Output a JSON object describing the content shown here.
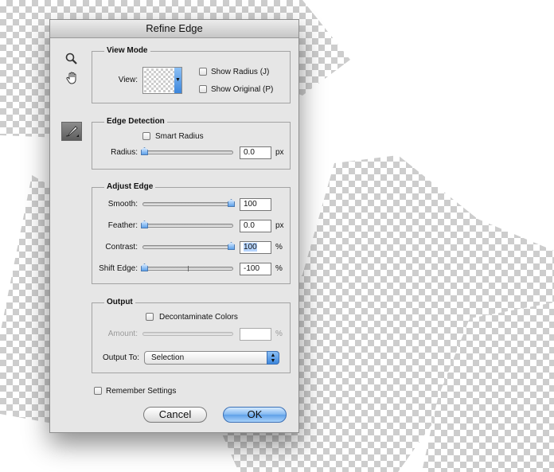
{
  "dialog": {
    "title": "Refine Edge"
  },
  "tools": {
    "zoom_icon": "magnifier-icon",
    "hand_icon": "hand-icon",
    "brush_icon": "refine-radius-brush-icon"
  },
  "view_mode": {
    "legend": "View Mode",
    "view_label": "View:",
    "show_radius": {
      "label": "Show Radius (J)",
      "checked": false
    },
    "show_original": {
      "label": "Show Original (P)",
      "checked": false
    }
  },
  "edge_detection": {
    "legend": "Edge Detection",
    "smart_radius": {
      "label": "Smart Radius",
      "checked": false
    },
    "radius": {
      "label": "Radius:",
      "value": "0.0",
      "unit": "px",
      "slider": 0
    }
  },
  "adjust_edge": {
    "legend": "Adjust Edge",
    "smooth": {
      "label": "Smooth:",
      "value": "100",
      "unit": "",
      "slider": 1
    },
    "feather": {
      "label": "Feather:",
      "value": "0.0",
      "unit": "px",
      "slider": 0
    },
    "contrast": {
      "label": "Contrast:",
      "value": "100",
      "unit": "%",
      "slider": 1
    },
    "shift_edge": {
      "label": "Shift Edge:",
      "value": "-100",
      "unit": "%",
      "slider": 0
    }
  },
  "output": {
    "legend": "Output",
    "decontaminate": {
      "label": "Decontaminate Colors",
      "checked": false
    },
    "amount": {
      "label": "Amount:",
      "value": "",
      "unit": "%"
    },
    "output_to": {
      "label": "Output To:",
      "selected": "Selection"
    }
  },
  "remember_settings": {
    "label": "Remember Settings",
    "checked": false
  },
  "buttons": {
    "cancel": "Cancel",
    "ok": "OK"
  },
  "colors": {
    "accent": "#5fa0e8",
    "dialog_bg": "#e6e6e6"
  }
}
